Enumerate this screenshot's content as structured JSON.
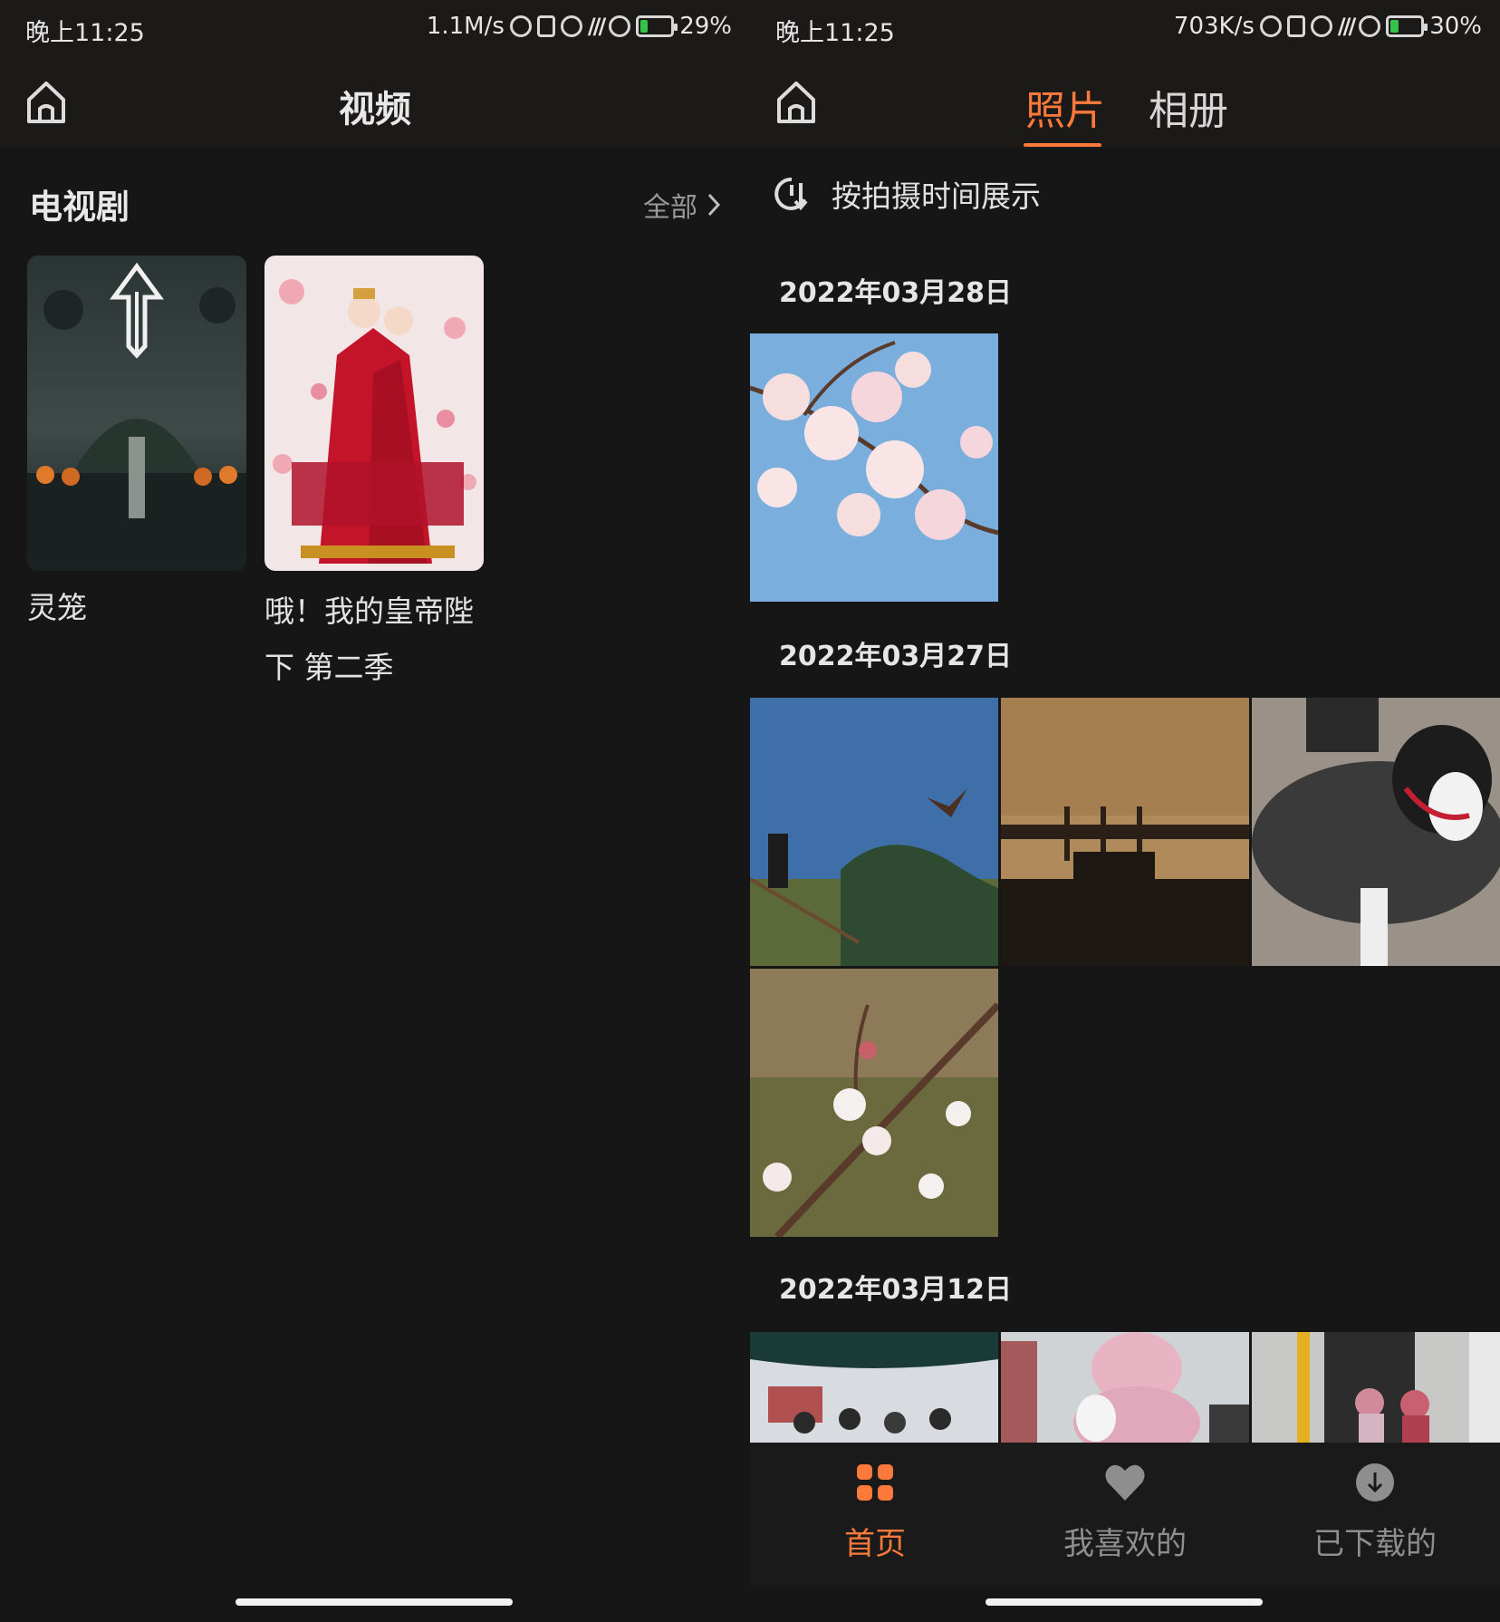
{
  "colors": {
    "accent": "#ff7a3a",
    "background": "#161616",
    "bar": "#1c1a19"
  },
  "left": {
    "status": {
      "time": "晚上11:25",
      "speed": "1.1M/s",
      "battery": "29%",
      "battery_level": 0.29
    },
    "title": "视频",
    "section": {
      "title": "电视剧",
      "see_all": "全部"
    },
    "cards": [
      {
        "title": "灵笼"
      },
      {
        "title": "哦！我的皇帝陛下 第二季"
      }
    ]
  },
  "right": {
    "status": {
      "time": "晚上11:25",
      "speed": "703K/s",
      "battery": "30%",
      "battery_level": 0.3
    },
    "tabs": {
      "photos": "照片",
      "albums": "相册"
    },
    "sort_label": "按拍摄时间展示",
    "groups": [
      {
        "date": "2022年03月28日"
      },
      {
        "date": "2022年03月27日"
      },
      {
        "date": "2022年03月12日"
      }
    ],
    "nav": {
      "home": "首页",
      "favorites": "我喜欢的",
      "downloaded": "已下载的"
    }
  }
}
